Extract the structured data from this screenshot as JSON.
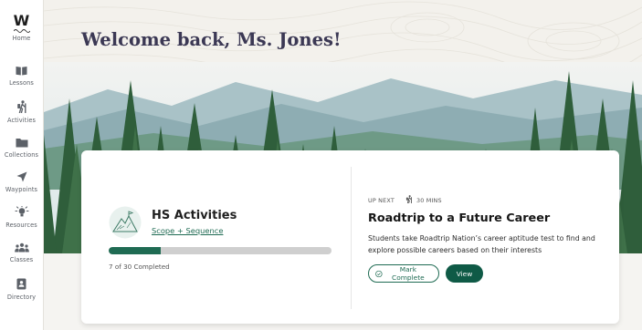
{
  "sidebar": {
    "logo": "W",
    "items": [
      {
        "label": "Home",
        "icon": "home-logo-icon"
      },
      {
        "label": "Lessons",
        "icon": "book-icon"
      },
      {
        "label": "Activities",
        "icon": "hiker-icon"
      },
      {
        "label": "Collections",
        "icon": "folder-icon"
      },
      {
        "label": "Waypoints",
        "icon": "navigation-arrow-icon"
      },
      {
        "label": "Resources",
        "icon": "lightbulb-icon"
      },
      {
        "label": "Classes",
        "icon": "people-icon"
      },
      {
        "label": "Directory",
        "icon": "contact-book-icon"
      }
    ]
  },
  "header": {
    "welcome": "Welcome back, Ms. Jones!"
  },
  "card": {
    "activity": {
      "title": "HS Activities",
      "link": "Scope + Sequence",
      "completed": 7,
      "total": 30,
      "completed_text": "7 of 30 Completed"
    },
    "up_next": {
      "label": "UP NEXT",
      "duration": "30 MINS",
      "title": "Roadtrip to a Future Career",
      "description": "Students take Roadtrip Nation’s career aptitude test to find and explore possible careers based on their interests",
      "mark_complete": "Mark Complete",
      "view": "View"
    }
  },
  "colors": {
    "accent": "#1f6b53",
    "accent_dark": "#0f5a46",
    "title": "#3b3854",
    "progress_track": "#cfcfcf"
  }
}
